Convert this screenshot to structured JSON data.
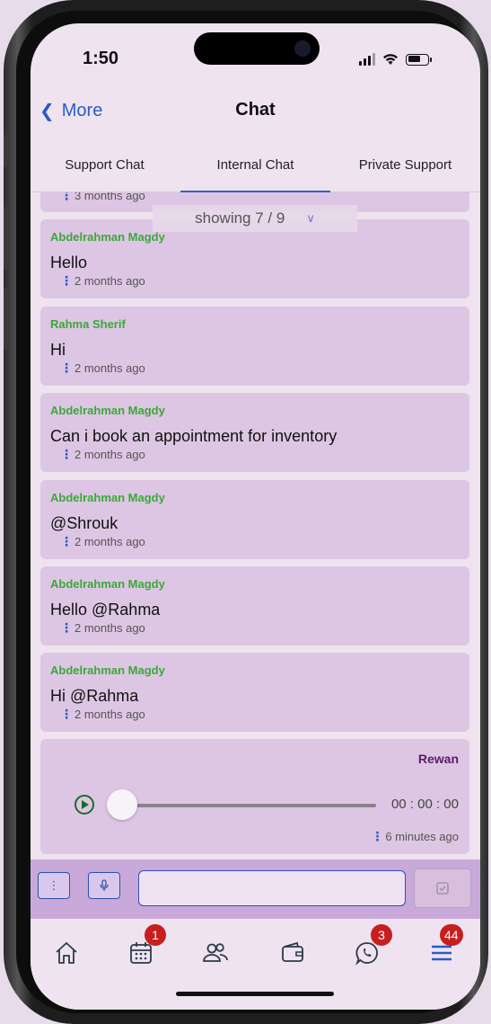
{
  "status_bar": {
    "time": "1:50"
  },
  "nav": {
    "back_label": "More",
    "title": "Chat"
  },
  "tabs": [
    {
      "label": "Support Chat",
      "active": false
    },
    {
      "label": "Internal Chat",
      "active": true
    },
    {
      "label": "Private Support",
      "active": false
    }
  ],
  "showing": {
    "text": "showing 7 / 9",
    "icon": "double-chevron-down-icon"
  },
  "messages": [
    {
      "sender": "",
      "text": "",
      "time": "3 months ago"
    },
    {
      "sender": "Abdelrahman Magdy",
      "text": "Hello",
      "time": "2 months ago"
    },
    {
      "sender": "Rahma Sherif",
      "text": "Hi",
      "time": "2 months ago"
    },
    {
      "sender": "Abdelrahman Magdy",
      "text": "Can i book an appointment for inventory",
      "time": "2 months ago"
    },
    {
      "sender": "Abdelrahman Magdy",
      "text": "@Shrouk",
      "time": "2 months ago"
    },
    {
      "sender": "Abdelrahman Magdy",
      "text": "Hello @Rahma",
      "time": "2 months ago"
    },
    {
      "sender": "Abdelrahman Magdy",
      "text": "Hi @Rahma",
      "time": "2 months ago"
    }
  ],
  "voice_message": {
    "sender": "Rewan",
    "duration": "00 : 00 : 00",
    "time": "6 minutes ago",
    "progress": 0
  },
  "composer": {
    "more_icon": "vertical-dots-icon",
    "mic_icon": "microphone-icon",
    "input_value": "",
    "send_icon": "send-check-icon"
  },
  "bottom_tabs": [
    {
      "icon": "home-icon",
      "badge": ""
    },
    {
      "icon": "calendar-icon",
      "badge": "1"
    },
    {
      "icon": "users-icon",
      "badge": ""
    },
    {
      "icon": "wallet-icon",
      "badge": ""
    },
    {
      "icon": "whatsapp-icon",
      "badge": "3"
    },
    {
      "icon": "menu-icon",
      "badge": "44"
    }
  ],
  "colors": {
    "sender_green": "#3aa838",
    "voice_sender_purple": "#5c1a6a",
    "link_blue": "#2a5bc7",
    "badge_red": "#c81e1e",
    "bubble_bg": "#ddc6e3"
  }
}
